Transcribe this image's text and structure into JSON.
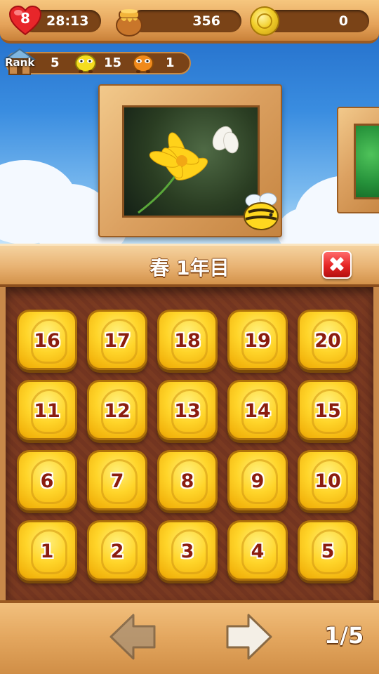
{
  "status": {
    "lives": "8",
    "timer": "28:13",
    "honey": "356",
    "coins": "0"
  },
  "rank": {
    "label": "Rank",
    "value": "5",
    "bug1_count": "15",
    "bug2_count": "1"
  },
  "stage": {
    "title": "春 1年目",
    "close_label": "✖"
  },
  "levels": {
    "row1": [
      "16",
      "17",
      "18",
      "19",
      "20"
    ],
    "row2": [
      "11",
      "12",
      "13",
      "14",
      "15"
    ],
    "row3": [
      "6",
      "7",
      "8",
      "9",
      "10"
    ],
    "row4": [
      "1",
      "2",
      "3",
      "4",
      "5"
    ]
  },
  "pager": {
    "page": "1/5"
  },
  "icons": {
    "lives": "heart-icon",
    "honey": "honey-pot-icon",
    "coin": "honeycomb-coin-icon",
    "rank": "house-icon",
    "prev": "left-arrow-icon",
    "next": "right-arrow-icon",
    "close": "close-icon"
  },
  "colors": {
    "accent_red": "#e52424",
    "level_tile": "#ffd52a",
    "wood": "#e3a65e",
    "level_number": "#8b1d0f"
  }
}
